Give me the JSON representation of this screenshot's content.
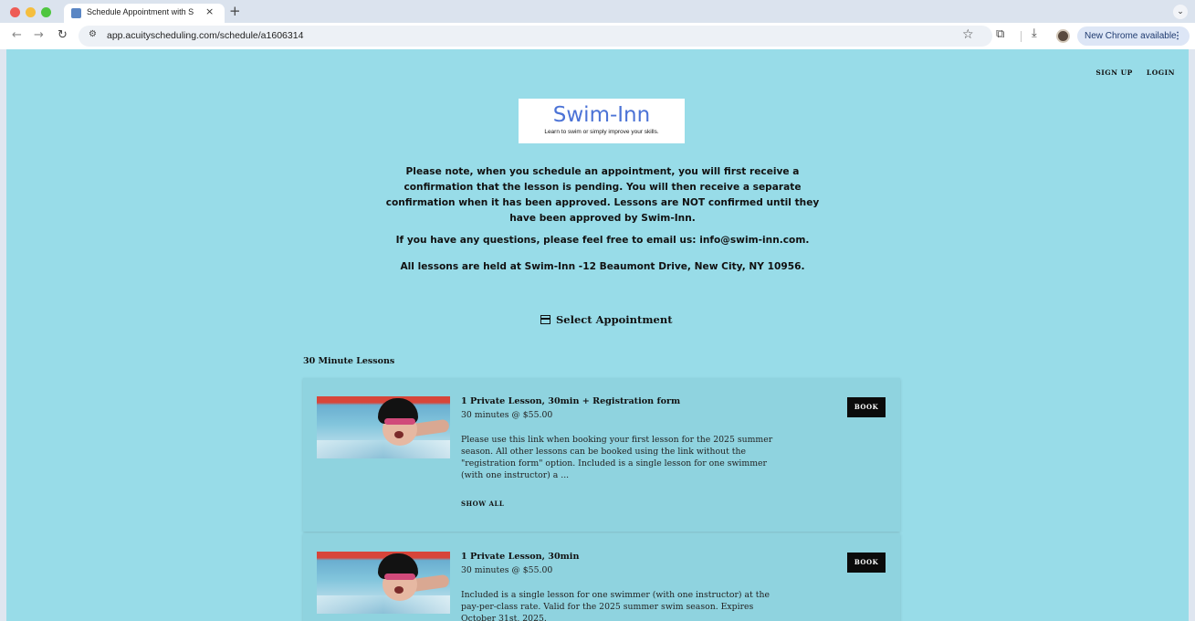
{
  "browser": {
    "tab_title": "Schedule Appointment with S",
    "tab_close": "×",
    "new_tab": "+",
    "tab_menu": "⌄",
    "url": "app.acuityscheduling.com/schedule/a1606314",
    "update_label": "New Chrome available",
    "update_menu": "⋮",
    "icons": [
      "back-icon",
      "forward-icon",
      "reload-icon",
      "site-info-icon",
      "star-icon",
      "extensions-icon",
      "download-icon"
    ]
  },
  "header": {
    "signup": "SIGN UP",
    "login": "LOGIN"
  },
  "logo": {
    "title": "Swim-Inn",
    "subtitle": "Learn to swim or simply improve your skills."
  },
  "notice": {
    "line1": "Please note, when you schedule an appointment, you will first receive a",
    "line2": "confirmation that the lesson is pending. You will then receive a separate",
    "line3": "confirmation when it has been approved. Lessons are NOT confirmed until they",
    "line4": "have been approved by Swim-Inn.",
    "questions": "If you have any questions, please feel free to email us: info@swim-inn.com.",
    "location": "All lessons are held at Swim-Inn -12 Beaumont Drive, New City, NY 10956."
  },
  "select_appointment": "Select Appointment",
  "section_title": "30 Minute Lessons",
  "lessons": [
    {
      "title": "1 Private Lesson, 30min + Registration form",
      "meta": "30 minutes @ $55.00",
      "desc_lines": [
        "Please use this link when booking your first lesson for the 2025 summer",
        "season. All other lessons can be booked using the link without the",
        "\"registration form\" option. Included is a single lesson for one swimmer",
        "(with one instructor) a ..."
      ],
      "show_all": "SHOW ALL",
      "book": "BOOK"
    },
    {
      "title": "1 Private Lesson, 30min",
      "meta": "30 minutes @ $55.00",
      "desc_lines": [
        "Included is a single lesson for one swimmer (with one instructor) at the",
        "pay-per-class rate. Valid for the 2025 summer swim season. Expires",
        "October 31st, 2025."
      ],
      "book": "BOOK"
    }
  ],
  "colors": {
    "page_bg": "#98dce8",
    "card_bg": "#8fd3df",
    "logo_text": "#4c73d6",
    "button_bg": "#0b0b0b"
  }
}
